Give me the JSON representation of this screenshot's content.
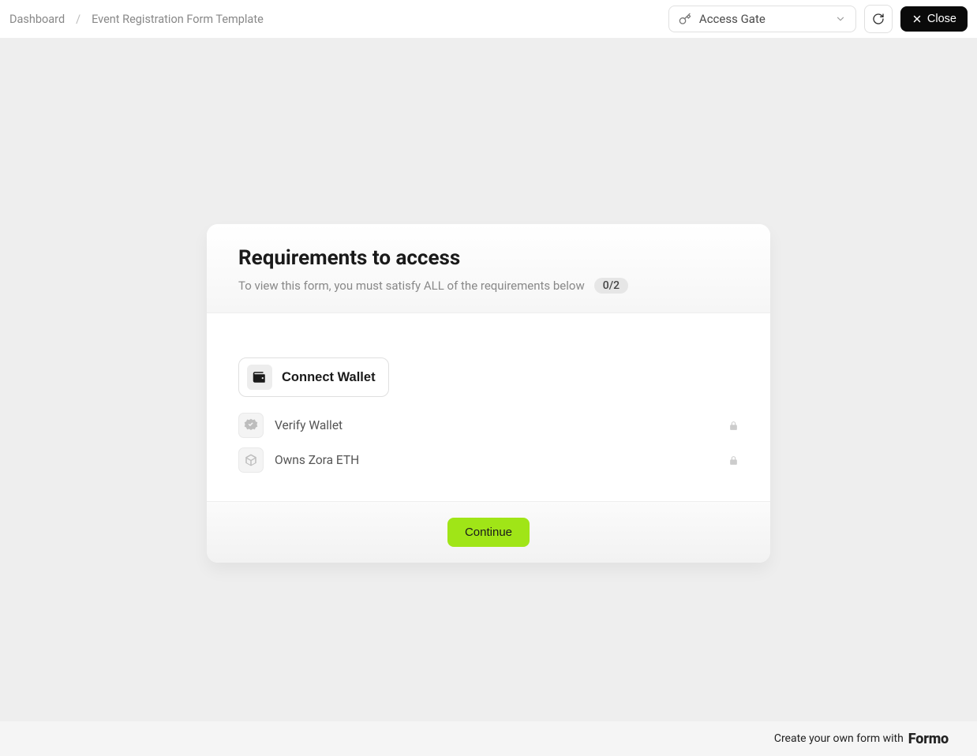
{
  "header": {
    "breadcrumb": {
      "dashboard": "Dashboard",
      "current": "Event Registration Form Template"
    },
    "access_gate_label": "Access Gate",
    "close_label": "Close"
  },
  "card": {
    "title": "Requirements to access",
    "subtitle": "To view this form, you must satisfy ALL of the requirements below",
    "progress": "0/2",
    "connect_wallet_label": "Connect Wallet",
    "requirements": [
      {
        "label": "Verify Wallet"
      },
      {
        "label": "Owns Zora ETH"
      }
    ],
    "continue_label": "Continue"
  },
  "footer": {
    "text": "Create your own form with",
    "brand": "Formo"
  }
}
